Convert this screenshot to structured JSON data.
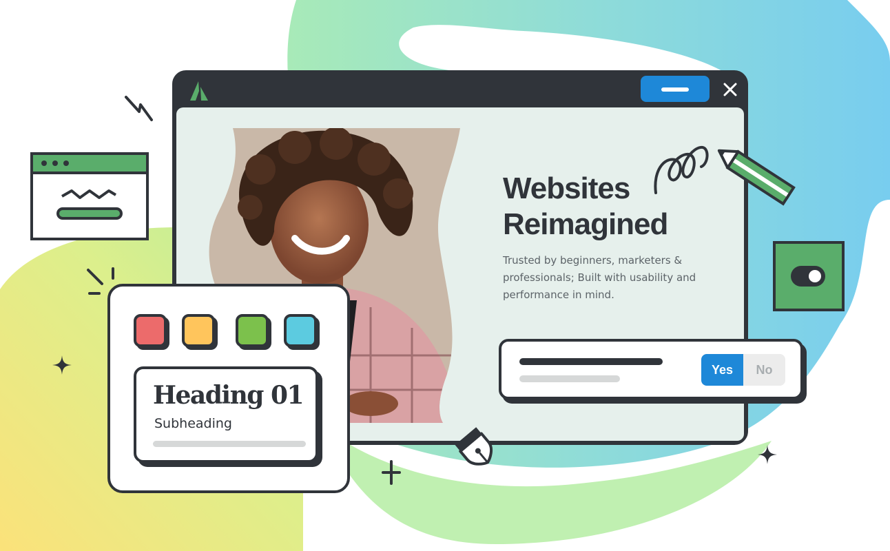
{
  "window": {
    "logo_icon": "triangle-logo-icon",
    "minimize_icon": "minimize-icon",
    "close_icon": "close-icon"
  },
  "hero": {
    "title_line1": "Websites",
    "title_line2": "Reimagined",
    "description": "Trusted by beginners, marketers & professionals; Built with usability and performance in mind."
  },
  "confirm": {
    "yes_label": "Yes",
    "no_label": "No",
    "selected": "Yes"
  },
  "palette": {
    "swatches": [
      {
        "color": "#ec6b6b"
      },
      {
        "color": "#ffc55c"
      },
      {
        "color": "#7cc14c"
      },
      {
        "color": "#5ccbe0"
      }
    ],
    "heading": "Heading 01",
    "subheading": "Subheading"
  },
  "toggle": {
    "state": "on"
  },
  "colors": {
    "dark": "#30343a",
    "accent_blue": "#1e88d8",
    "green": "#5aad6b",
    "content_bg": "#e6f0ec"
  }
}
